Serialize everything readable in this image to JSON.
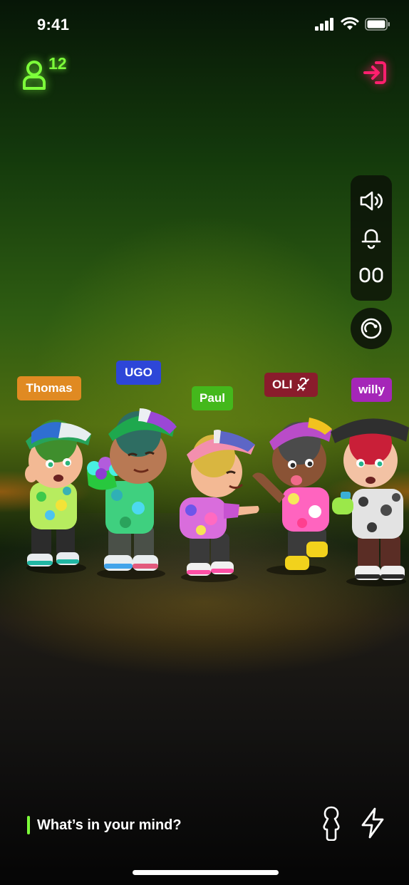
{
  "status_bar": {
    "time": "9:41"
  },
  "header": {
    "friends_count": "12"
  },
  "name_tags": [
    {
      "label": "Thomas",
      "color": "#e08a22"
    },
    {
      "label": "UGO",
      "color": "#2d46d8"
    },
    {
      "label": "Paul",
      "color": "#44b81c"
    },
    {
      "label": "OLI",
      "color": "#8a1c2c",
      "muted": true
    },
    {
      "label": "willy",
      "color": "#a526b8"
    }
  ],
  "side_panel": {
    "items": [
      "speaker-icon",
      "bell-icon",
      "glasses-icon"
    ],
    "extra": "sticker-icon"
  },
  "composer": {
    "placeholder": "What’s in your mind?"
  },
  "colors": {
    "accent_green": "#7dff3a",
    "accent_pink": "#ff1f6e"
  }
}
